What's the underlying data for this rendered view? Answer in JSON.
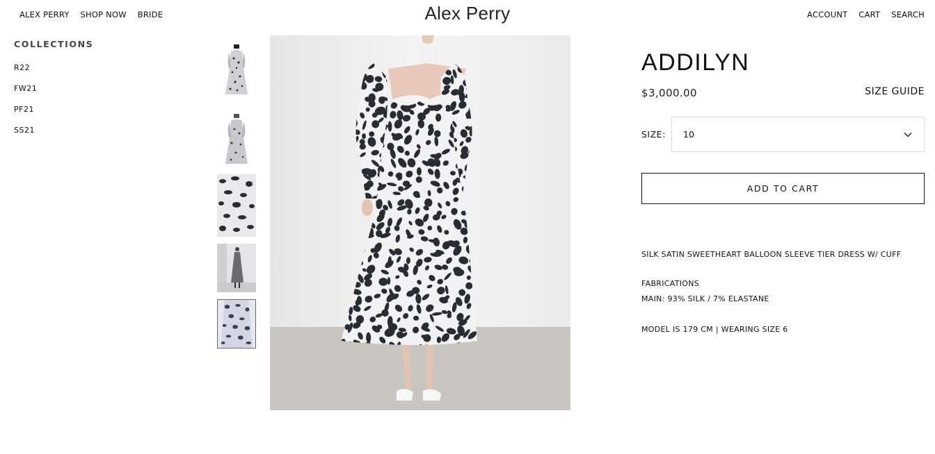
{
  "nav": {
    "left": [
      "ALEX PERRY",
      "SHOP NOW",
      "BRIDE"
    ],
    "logo": "Alex Perry",
    "right": [
      "ACCOUNT",
      "CART",
      "SEARCH"
    ]
  },
  "collections": {
    "heading": "COLLECTIONS",
    "items": [
      "R22",
      "FW21",
      "PF21",
      "SS21"
    ]
  },
  "thumbnails": [
    "thumb-full-dress-front",
    "thumb-full-dress-back",
    "thumb-print-detail",
    "thumb-model-grey-backdrop",
    "thumb-dress-closeup"
  ],
  "product": {
    "title": "ADDILYN",
    "price": "$3,000.00",
    "size_guide": "SIZE GUIDE",
    "size_label": "SIZE:",
    "size_value": "10",
    "add_to_cart": "ADD TO CART",
    "description": "SILK SATIN SWEETHEART BALLOON SLEEVE TIER DRESS W/ CUFF",
    "fabrications_heading": "FABRICATIONS",
    "fabrications_main": "MAIN: 93% SILK / 7% ELASTANE",
    "model_info": "MODEL IS 179 CM | WEARING SIZE 6"
  },
  "colors": {
    "text": "#111111",
    "border_light": "#dddddd",
    "print_dark": "#2a2c33",
    "print_light": "#f2f2f4"
  }
}
